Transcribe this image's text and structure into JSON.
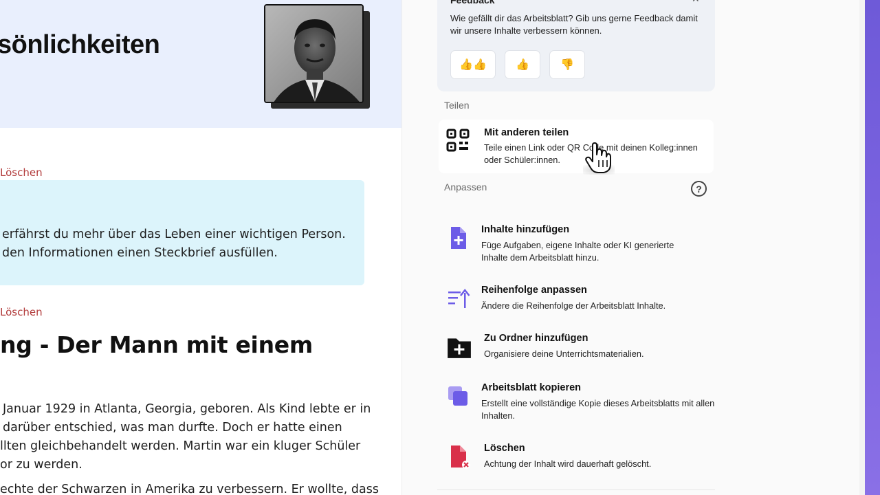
{
  "worksheet": {
    "hero_title": "sönlichkeiten",
    "portrait_alt": "Portrait photo",
    "delete_label_1": "Löschen",
    "delete_label_2": "Löschen",
    "info_line_1": "erfährst du mehr über das Leben einer wichtigen Person.",
    "info_line_2": "den Informationen einen Steckbrief ausfüllen.",
    "section_title": "ng - Der Mann mit einem",
    "body_lines": [
      "Januar 1929 in Atlanta, Georgia, geboren. Als Kind lebte er in",
      "darüber entschied, was man durfte. Doch er hatte einen",
      "llten gleichbehandelt werden. Martin war ein kluger Schüler",
      "or zu werden.",
      "echte der Schwarzen in Amerika zu verbessern. Er wollte, dass"
    ]
  },
  "panel": {
    "feedback": {
      "heading": "Feedback",
      "text": "Wie gefällt dir das Arbeitsblatt? Gib uns gerne Feedback damit wir unsere Inhalte verbessern können.",
      "close_icon": "close-icon",
      "love_label": "👍👍",
      "like_label": "👍",
      "dislike_label": "👎"
    },
    "share_section_label": "Teilen",
    "customize_section_label": "Anpassen",
    "help_label": "?",
    "actions": {
      "share": {
        "title": "Mit anderen teilen",
        "desc": "Teile einen Link oder QR Code mit deinen Kolleg:innen oder Schüler:innen.",
        "icon": "qr-code-icon"
      },
      "add": {
        "title": "Inhalte hinzufügen",
        "desc": "Füge Aufgaben, eigene Inhalte oder KI generierte Inhalte dem Arbeitsblatt hinzu.",
        "icon": "add-document-icon"
      },
      "order": {
        "title": "Reihenfolge anpassen",
        "desc": "Ändere die Reihenfolge der Arbeitsblatt Inhalte.",
        "icon": "sort-icon"
      },
      "folder": {
        "title": "Zu Ordner hinzufügen",
        "desc": "Organisiere deine Unterrichtsmaterialien.",
        "icon": "folder-add-icon"
      },
      "copy": {
        "title": "Arbeitsblatt kopieren",
        "desc": "Erstellt eine vollständige Kopie dieses Arbeitsblatts mit allen Inhalten.",
        "icon": "copy-icon"
      },
      "delete": {
        "title": "Löschen",
        "desc": "Achtung der Inhalt wird dauerhaft gelöscht.",
        "icon": "delete-document-icon"
      }
    }
  },
  "colors": {
    "hero_bg": "#e9effd",
    "info_bg": "#dcf4fb",
    "delete_red": "#b23b3b",
    "accent_purple": "#6c5ce7",
    "danger_red": "#d9304a"
  }
}
